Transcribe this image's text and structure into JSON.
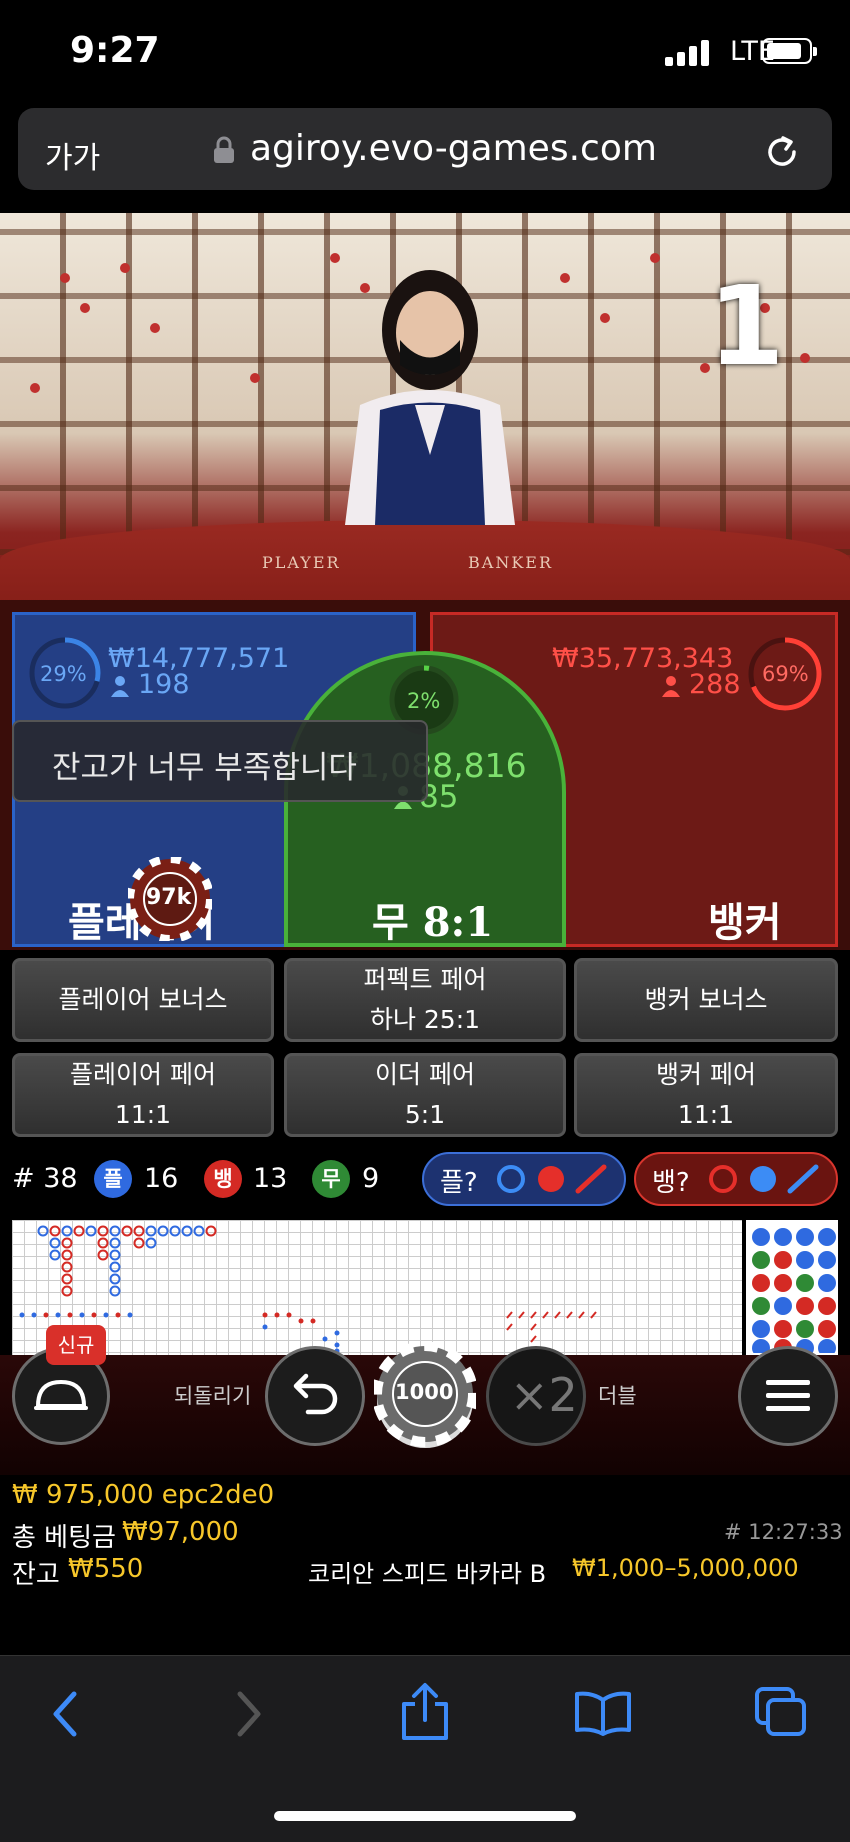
{
  "status_bar": {
    "time": "9:27",
    "carrier": "LTE"
  },
  "browser": {
    "text_size_button": "가가",
    "url": "agiroy.evo-games.com"
  },
  "video": {
    "round_number": "1",
    "table_label_player": "PLAYER",
    "table_label_banker": "BANKER"
  },
  "bets": {
    "player": {
      "percent": "29%",
      "amount": "₩14,777,571",
      "players": "198",
      "label": "플레이어",
      "chip": "97k"
    },
    "tie": {
      "percent": "2%",
      "amount": "₩1,088,816",
      "players": "85",
      "label": "무 8:1"
    },
    "banker": {
      "percent": "69%",
      "amount": "₩35,773,343",
      "players": "288",
      "label": "뱅커"
    }
  },
  "toast": {
    "message": "잔고가 너무 부족합니다"
  },
  "side_bets": [
    {
      "line1": "플레이어 보너스",
      "line2": ""
    },
    {
      "line1": "퍼펙트 페어",
      "line2": "하나 25:1"
    },
    {
      "line1": "뱅커 보너스",
      "line2": ""
    },
    {
      "line1": "플레이어 페어",
      "line2": "11:1"
    },
    {
      "line1": "이더 페어",
      "line2": "5:1"
    },
    {
      "line1": "뱅커 페어",
      "line2": "11:1"
    }
  ],
  "stats": {
    "rounds_label": "# 38",
    "player_icon": "플",
    "player_count": "16",
    "banker_icon": "뱅",
    "banker_count": "13",
    "tie_icon": "무",
    "tie_count": "9",
    "player_predict": "플?",
    "banker_predict": "뱅?"
  },
  "controls": {
    "new_badge": "신규",
    "undo_label": "되돌리기",
    "chip_value": "1000",
    "double_symbol": "×2",
    "double_label": "더블"
  },
  "info": {
    "account": "₩ 975,000 epc2de0",
    "total_bet_label": "총 베팅금",
    "total_bet_value": "₩97,000",
    "game_id": "# 12:27:33",
    "balance_label": "잔고",
    "balance_value": "₩550",
    "table_name": "코리안 스피드 바카라 B",
    "limits": "₩1,000–5,000,000"
  },
  "colors": {
    "player_blue": "#2b63c8",
    "banker_red": "#c72a25",
    "tie_green": "#49b23a",
    "accent_yellow": "#f7c72a",
    "safari_blue": "#3d8af7"
  }
}
